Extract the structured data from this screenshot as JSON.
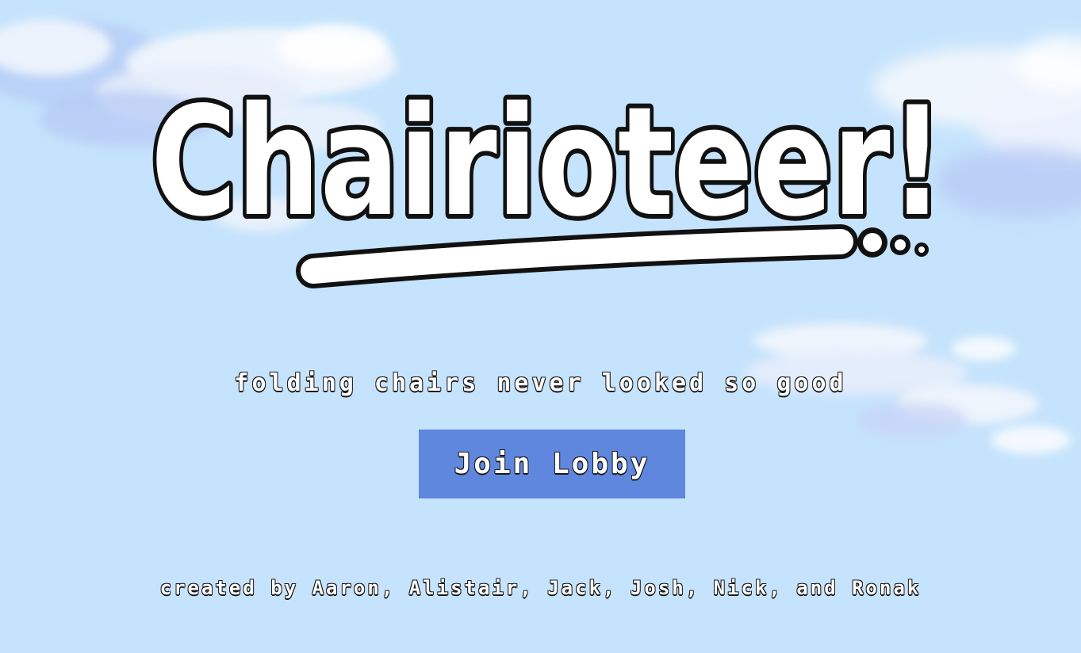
{
  "game": {
    "title": "Chairioteer!",
    "tagline": "folding chairs never looked so good",
    "join_button_label": "Join Lobby",
    "credits": "created by Aaron, Alistair, Jack, Josh, Nick, and Ronak"
  },
  "colors": {
    "sky": "#c5e3fc",
    "button": "#5f87de",
    "text_fill": "#ffffff",
    "outline": "#111111"
  }
}
